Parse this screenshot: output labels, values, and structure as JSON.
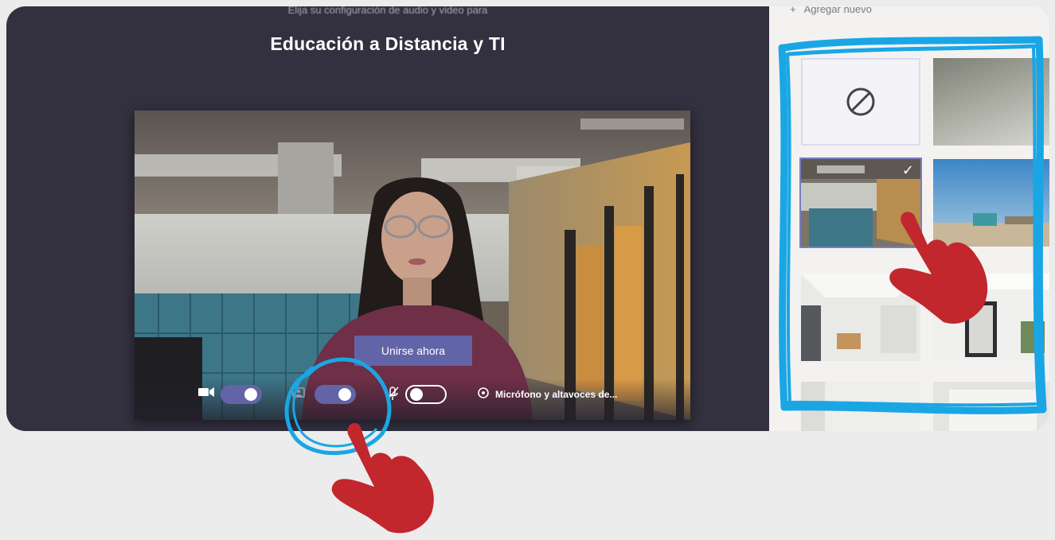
{
  "prejoin": {
    "subtitle": "Elija su configuración de audio y video para",
    "title": "Educación a Distancia y TI",
    "join_button_label": "Unirse ahora",
    "controls": {
      "camera_icon": "video-camera-icon",
      "camera_toggle_on": true,
      "background_effects_icon": "background-effects-icon",
      "background_effects_toggle_on": true,
      "mic_icon": "mic-off-icon",
      "mic_toggle_on": false,
      "device_settings_icon": "gear-icon",
      "device_settings_label": "Micrófono y altavoces de..."
    }
  },
  "background_settings": {
    "add_new_label": "Agregar nuevo",
    "add_new_icon": "plus-icon",
    "none_option_icon": "no-background-icon",
    "selected_icon": "checkmark-icon",
    "thumbnails": [
      "none",
      "blur",
      "office-lockers",
      "beach-town",
      "white-loft",
      "white-room",
      "white-interior-1",
      "white-interior-2"
    ],
    "selected_index": 2
  },
  "annotations": {
    "highlight_color": "#1aa6e4",
    "hand_color": "#c1272d"
  },
  "colors": {
    "panel_bg": "#33303f",
    "accent": "#6264a7",
    "page_bg": "#ececec"
  }
}
